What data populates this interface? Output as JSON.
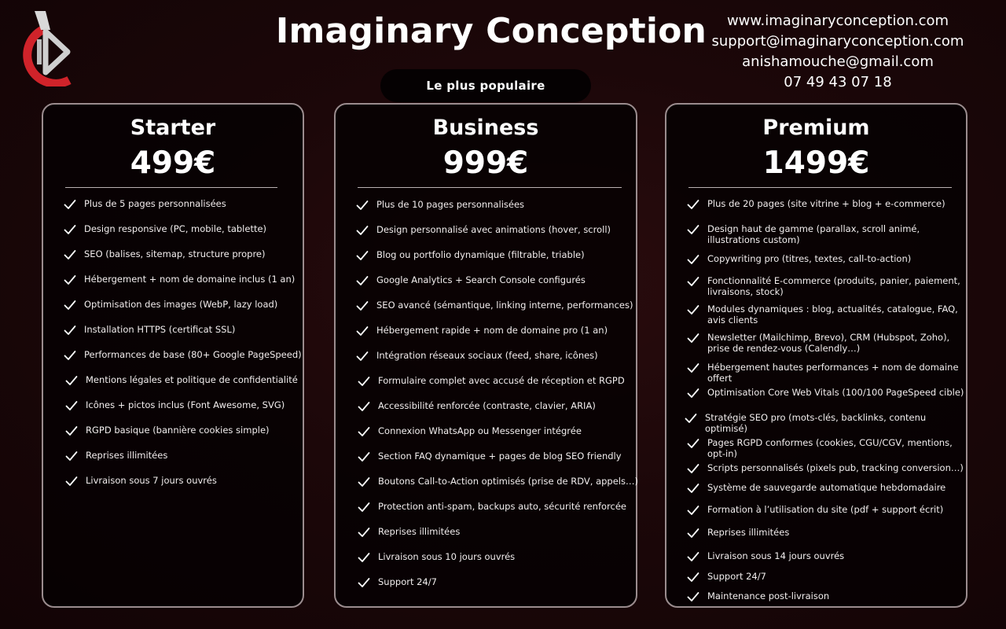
{
  "brand": {
    "title": "Imaginary Conception",
    "logo_icon": "play-logo-icon",
    "colors": {
      "accent": "#d0232a",
      "silver": "#c8c8c8",
      "background": "#1c0709"
    }
  },
  "contact": {
    "website": "www.imaginaryconception.com",
    "email_support": "support@imaginaryconception.com",
    "email_personal": "anishamouche@gmail.com",
    "phone": "07 49 43 07 18"
  },
  "badge": {
    "label": "Le plus populaire"
  },
  "plans": [
    {
      "name": "Starter",
      "price": "499€",
      "features": [
        "Plus de 5 pages personnalisées",
        "Design responsive (PC, mobile, tablette)",
        "SEO (balises, sitemap, structure propre)",
        "Hébergement + nom de domaine inclus (1 an)",
        "Optimisation des images (WebP, lazy load)",
        "Installation HTTPS (certificat SSL)",
        "Performances de base (80+ Google PageSpeed)",
        "Mentions légales et politique de confidentialité",
        "Icônes + pictos inclus (Font Awesome, SVG)",
        "RGPD basique (bannière cookies simple)",
        "Reprises illimitées",
        "Livraison sous 7 jours ouvrés"
      ]
    },
    {
      "name": "Business",
      "price": "999€",
      "features": [
        "Plus de 10 pages personnalisées",
        "Design personnalisé avec animations (hover, scroll)",
        "Blog ou portfolio dynamique (filtrable, triable)",
        "Google Analytics + Search Console configurés",
        "SEO avancé (sémantique, linking interne, performances)",
        "Hébergement rapide + nom de domaine pro (1 an)",
        "Intégration réseaux sociaux (feed, share, icônes)",
        "Formulaire complet avec accusé de réception et RGPD",
        "Accessibilité renforcée (contraste, clavier, ARIA)",
        "Connexion WhatsApp ou Messenger intégrée",
        "Section FAQ dynamique + pages de blog SEO friendly",
        "Boutons Call-to-Action optimisés (prise de RDV, appels…)",
        "Protection anti-spam, backups auto, sécurité renforcée",
        "Reprises illimitées",
        "Livraison sous 10 jours ouvrés",
        "Support 24/7"
      ]
    },
    {
      "name": "Premium",
      "price": "1499€",
      "features": [
        "Plus de 20 pages (site vitrine + blog + e-commerce)",
        "Design haut de gamme (parallax, scroll animé, illustrations custom)",
        "Copywriting pro (titres, textes, call-to-action)",
        "Fonctionnalité E-commerce (produits, panier, paiement, livraisons, stock)",
        "Modules dynamiques : blog, actualités, catalogue, FAQ, avis clients",
        "Newsletter (Mailchimp, Brevo), CRM (Hubspot, Zoho), prise de rendez-vous (Calendly…)",
        "Hébergement hautes performances + nom de domaine offert",
        "Optimisation Core Web Vitals (100/100 PageSpeed cible)",
        "Stratégie SEO pro (mots-clés, backlinks, contenu optimisé)",
        "Pages RGPD conformes (cookies, CGU/CGV, mentions, opt-in)",
        "Scripts personnalisés (pixels pub, tracking conversion…)",
        "Système de sauvegarde automatique hebdomadaire",
        "Formation à l’utilisation du site (pdf + support écrit)",
        "Reprises illimitées",
        "Livraison sous 14 jours ouvrés",
        "Support 24/7",
        "Maintenance post-livraison"
      ]
    }
  ]
}
